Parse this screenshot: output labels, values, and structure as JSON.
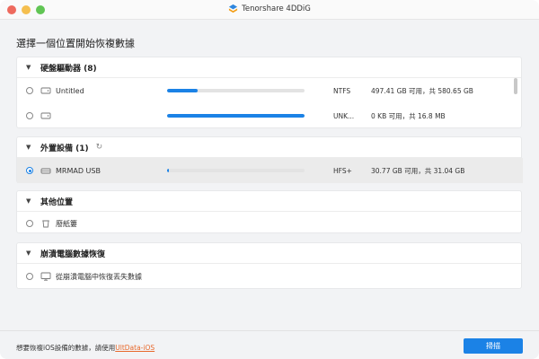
{
  "window": {
    "title": "Tenorshare 4DDiG"
  },
  "page_title": "選擇一個位置開始恢複數據",
  "sections": {
    "hard_drives": {
      "title": "硬盤驅動器 (8)",
      "rows": [
        {
          "label": "Untitled",
          "fs": "NTFS",
          "capacity": "497.41 GB 可用，共 580.65 GB",
          "usage": 0.22
        },
        {
          "label": "",
          "fs": "UNK...",
          "capacity": "0 KB 可用，共 16.8 MB",
          "usage": 1.0
        }
      ]
    },
    "external": {
      "title": "外置設備 (1)",
      "rows": [
        {
          "label": "MRMAD USB",
          "fs": "HFS+",
          "capacity": "30.77 GB 可用，共 31.04 GB",
          "usage": 0.01,
          "selected": true
        }
      ]
    },
    "other": {
      "title": "其他位置",
      "rows": [
        {
          "label": "廢紙簍"
        }
      ]
    },
    "crash": {
      "title": "崩潰電腦數據恢復",
      "rows": [
        {
          "label": "從崩潰電腦中恢復丟失數據"
        }
      ]
    }
  },
  "footer": {
    "text": "想要恢複iOS設備的數據，請使用",
    "link": "UltData-iOS",
    "scan_button": "掃描"
  },
  "colors": {
    "accent": "#1b82e6",
    "link": "#e8692c"
  }
}
